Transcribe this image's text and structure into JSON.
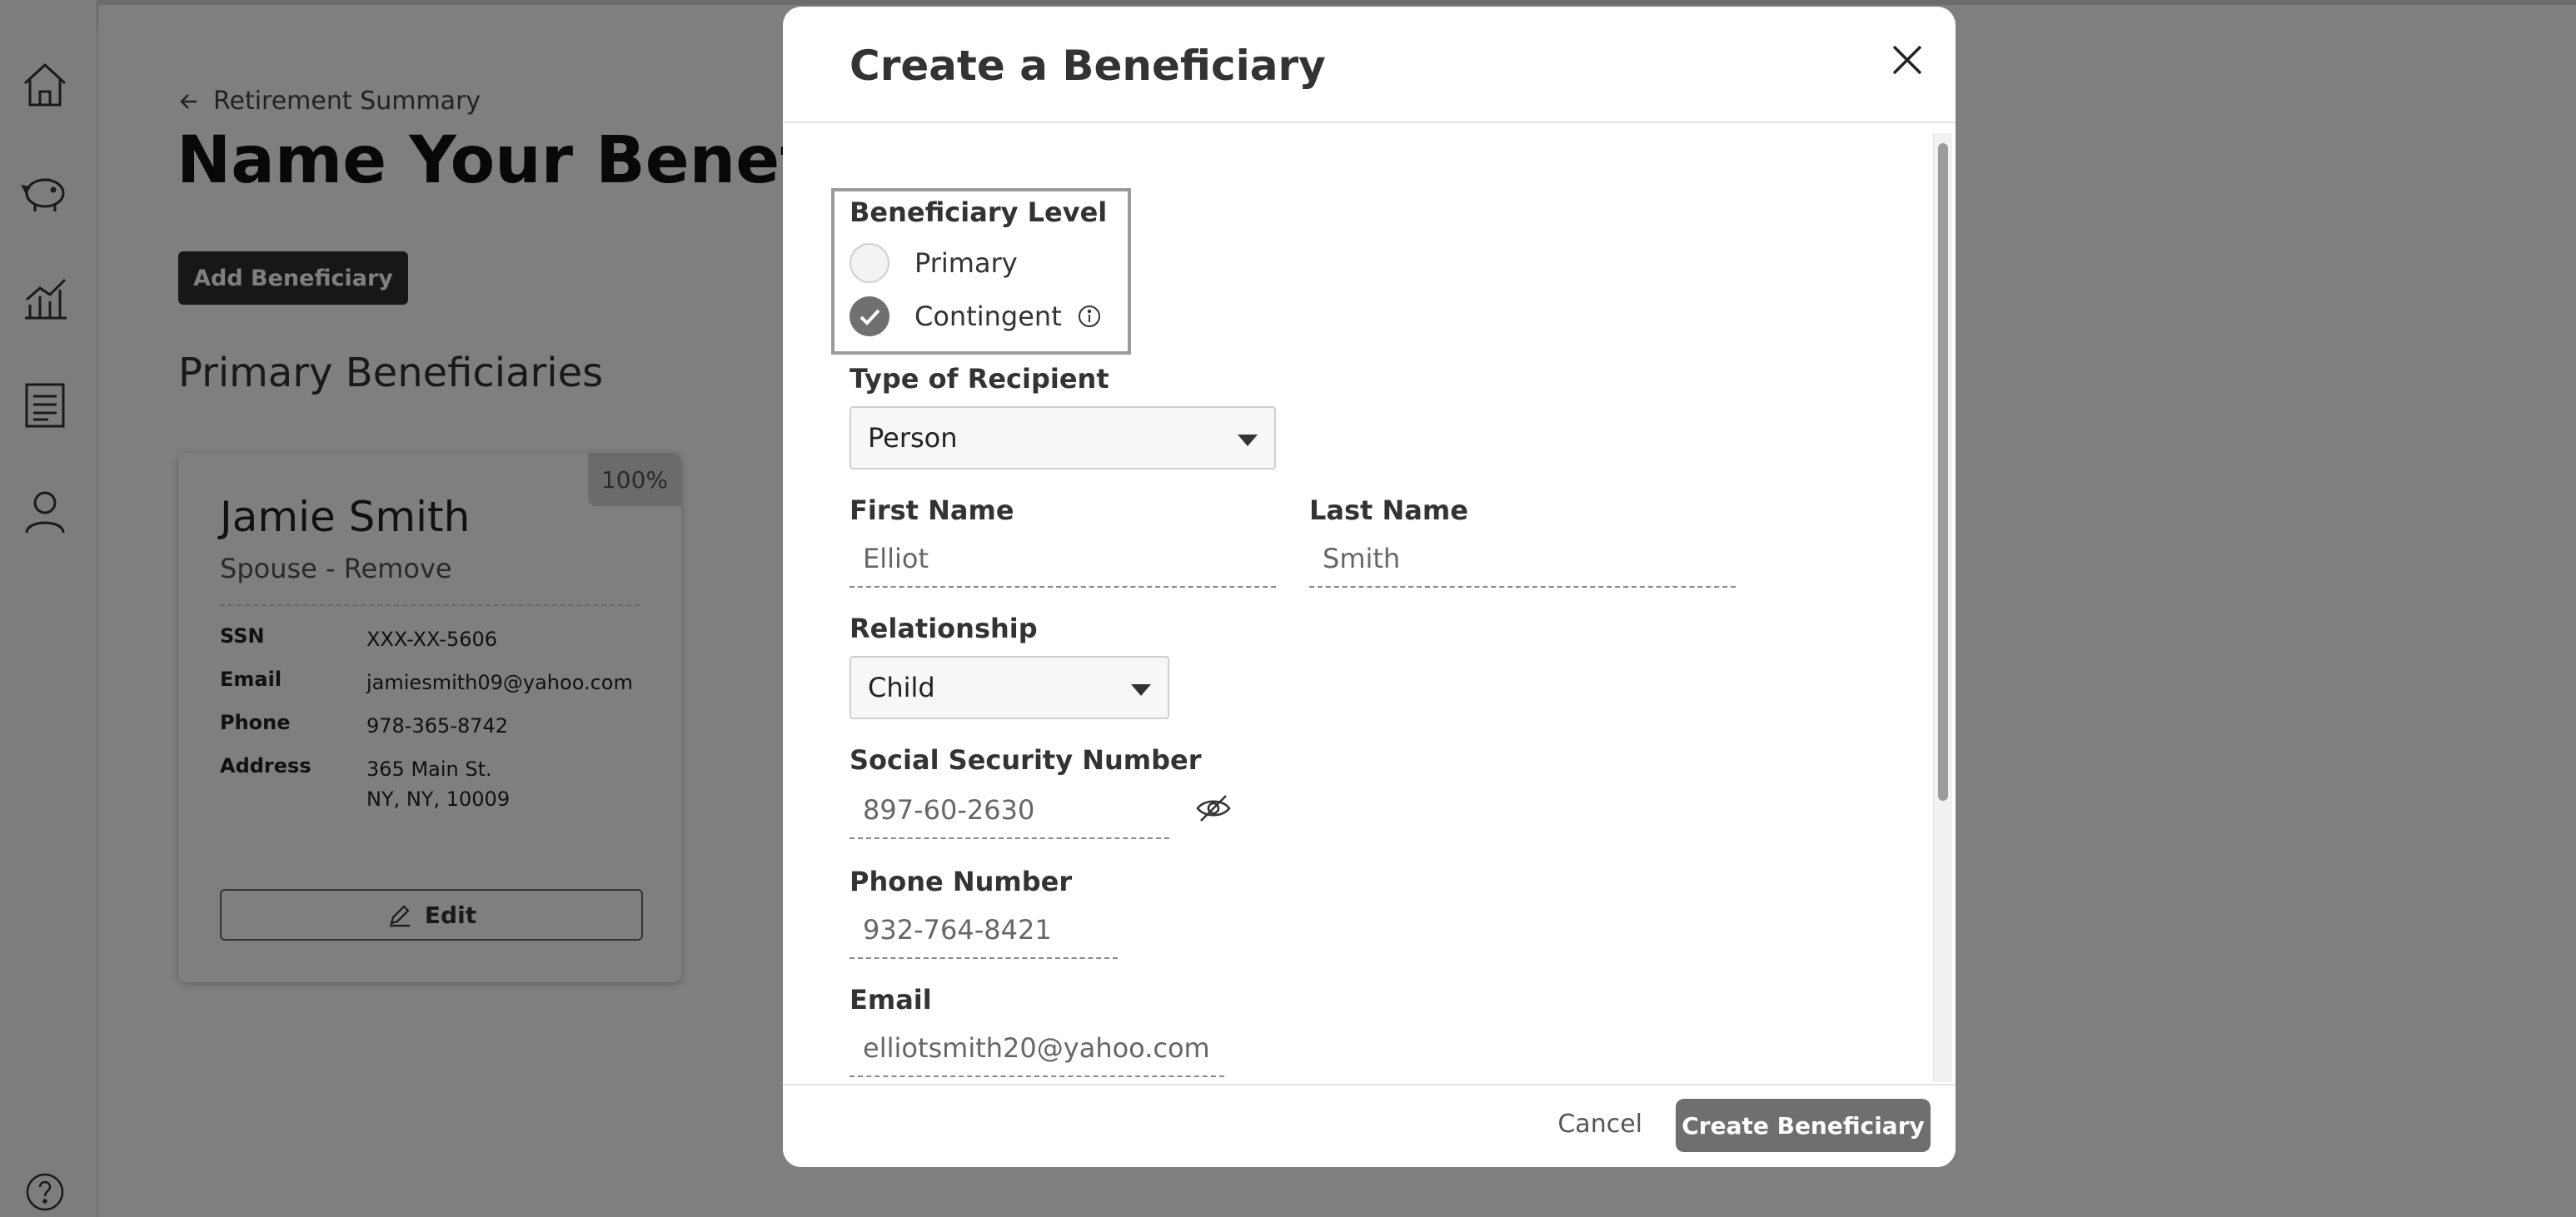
{
  "sidebar": {
    "icons": [
      "home-icon",
      "piggy-bank-icon",
      "chart-icon",
      "document-icon",
      "user-icon"
    ],
    "help_icon": "help-icon"
  },
  "page": {
    "back_label": "Retirement Summary",
    "title": "Name Your Beneficiary",
    "add_button": "Add Beneficiary",
    "section_title": "Primary Beneficiaries"
  },
  "card": {
    "percent": "100%",
    "name": "Jamie Smith",
    "subtitle": "Spouse - Remove",
    "rows": [
      {
        "key": "SSN",
        "value": "XXX-XX-5606"
      },
      {
        "key": "Email",
        "value": "jamiesmith09@yahoo.com"
      },
      {
        "key": "Phone",
        "value": "978-365-8742"
      },
      {
        "key": "Address",
        "value": "365 Main St.",
        "value2": "NY, NY, 10009"
      }
    ],
    "edit_label": "Edit"
  },
  "modal": {
    "title": "Create a Beneficiary",
    "beneficiary_level_label": "Beneficiary Level",
    "level_options": [
      {
        "label": "Primary",
        "selected": false
      },
      {
        "label": "Contingent",
        "selected": true
      }
    ],
    "recipient_type_label": "Type of Recipient",
    "recipient_type_value": "Person",
    "first_name_label": "First Name",
    "first_name_value": "Elliot",
    "last_name_label": "Last Name",
    "last_name_value": "Smith",
    "relationship_label": "Relationship",
    "relationship_value": "Child",
    "ssn_label": "Social Security Number",
    "ssn_value": "897-60-2630",
    "phone_label": "Phone Number",
    "phone_value": "932-764-8421",
    "email_label": "Email",
    "email_value": "elliotsmith20@yahoo.com",
    "cancel_label": "Cancel",
    "create_label": "Create Beneficiary"
  },
  "colors": {
    "overlay": "#000000",
    "primary_button": "#2f2f2f",
    "create_button": "#6f6f6f"
  }
}
